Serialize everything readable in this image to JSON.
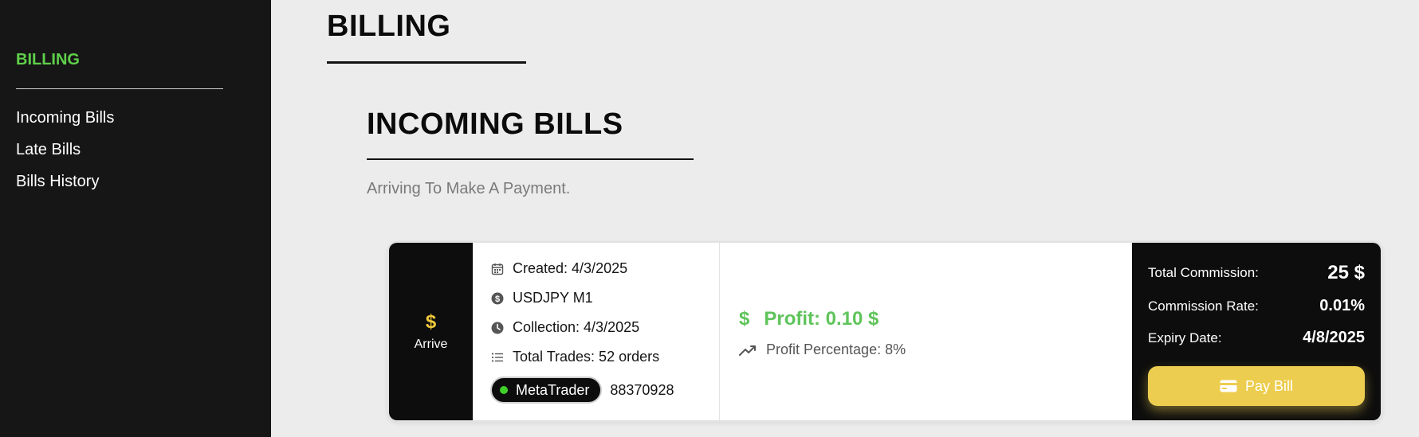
{
  "sidebar": {
    "title": "BILLING",
    "items": [
      {
        "label": "Incoming Bills"
      },
      {
        "label": "Late Bills"
      },
      {
        "label": "Bills History"
      }
    ]
  },
  "page": {
    "title": "BILLING"
  },
  "section": {
    "title": "INCOMING BILLS",
    "subtitle": "Arriving To Make A Payment."
  },
  "bill": {
    "status_symbol": "$",
    "status_label": "Arrive",
    "created": "Created: 4/3/2025",
    "pair": "USDJPY M1",
    "collection": "Collection: 4/3/2025",
    "total_trades": "Total Trades: 52 orders",
    "platform": "MetaTrader",
    "account_number": "88370928",
    "profit_symbol": "$",
    "profit": "Profit: 0.10 $",
    "profit_percentage": "Profit Percentage: 8%",
    "total_commission_label": "Total Commission:",
    "total_commission_value": "25 $",
    "commission_rate_label": "Commission Rate:",
    "commission_rate_value": "0.01%",
    "expiry_date_label": "Expiry Date:",
    "expiry_date_value": "4/8/2025",
    "pay_button_label": "Pay Bill"
  },
  "colors": {
    "accent_green": "#5ed04a",
    "accent_yellow": "#eccd4f",
    "sidebar_bg": "#161616",
    "page_bg": "#ececec"
  },
  "icons": [
    "calendar-icon",
    "dollar-circle-icon",
    "clock-icon",
    "list-icon",
    "status-dot-icon",
    "trending-up-icon",
    "credit-card-icon"
  ]
}
